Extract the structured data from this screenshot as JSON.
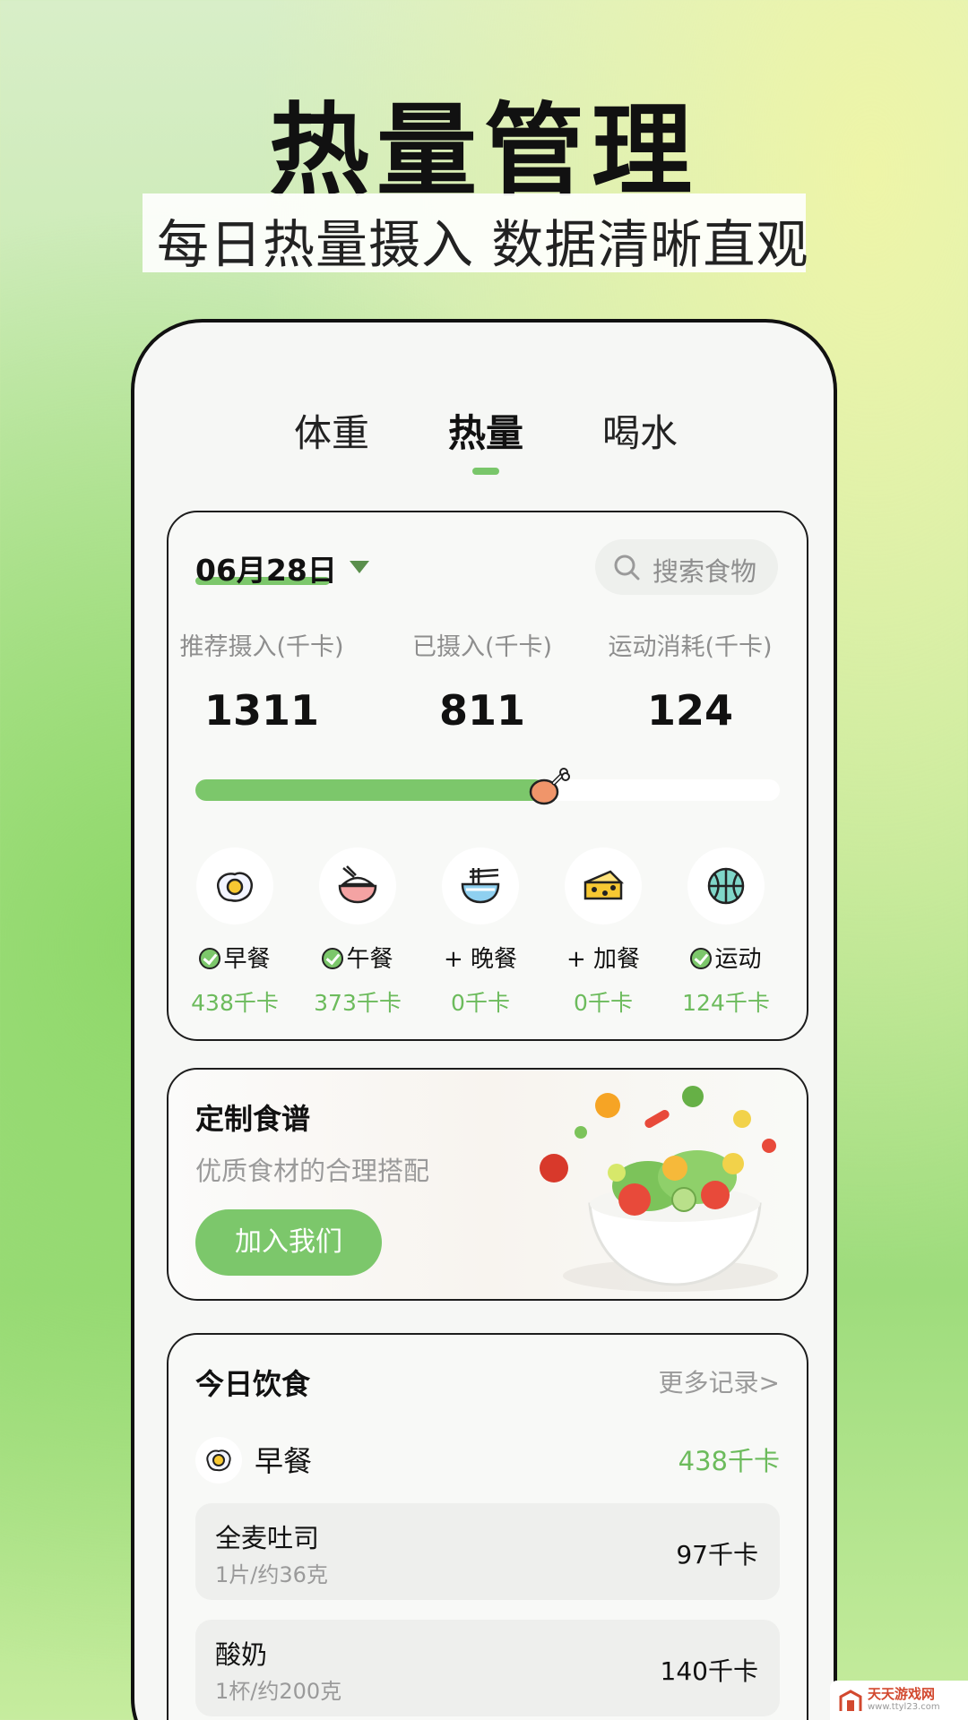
{
  "promo": {
    "headline": "热量管理",
    "subtitle": "每日热量摄入 数据清晰直观"
  },
  "tabs": [
    {
      "label": "体重",
      "active": false
    },
    {
      "label": "热量",
      "active": true
    },
    {
      "label": "喝水",
      "active": false
    }
  ],
  "summary": {
    "date": "06月28日",
    "search_placeholder": "搜索食物",
    "stats": [
      {
        "label": "推荐摄入(千卡)",
        "value": "1311"
      },
      {
        "label": "已摄入(千卡)",
        "value": "811"
      },
      {
        "label": "运动消耗(千卡)",
        "value": "124"
      }
    ],
    "progress_fraction": 0.6,
    "meals": [
      {
        "name": "早餐",
        "kcal": "438千卡",
        "checked": true,
        "icon": "fried-egg-icon"
      },
      {
        "name": "午餐",
        "kcal": "373千卡",
        "checked": true,
        "icon": "rice-bowl-icon"
      },
      {
        "name": "+ 晚餐",
        "kcal": "0千卡",
        "checked": false,
        "icon": "noodle-bowl-icon"
      },
      {
        "name": "+ 加餐",
        "kcal": "0千卡",
        "checked": false,
        "icon": "cheese-icon"
      },
      {
        "name": "运动",
        "kcal": "124千卡",
        "checked": true,
        "icon": "basketball-icon"
      }
    ]
  },
  "recipe": {
    "title": "定制食谱",
    "description": "优质食材的合理搭配",
    "button": "加入我们"
  },
  "diet": {
    "title": "今日饮食",
    "more": "更多记录>",
    "breakfast_label": "早餐",
    "breakfast_kcal": "438千卡",
    "items": [
      {
        "name": "全麦吐司",
        "portion": "1片/约36克",
        "kcal": "97千卡"
      },
      {
        "name": "酸奶",
        "portion": "1杯/约200克",
        "kcal": "140千卡"
      }
    ]
  },
  "watermark": {
    "name": "天天游戏网",
    "url": "www.ttyl23.com"
  },
  "colors": {
    "accent": "#7cc76b",
    "kcal_text": "#6cbb5c"
  }
}
